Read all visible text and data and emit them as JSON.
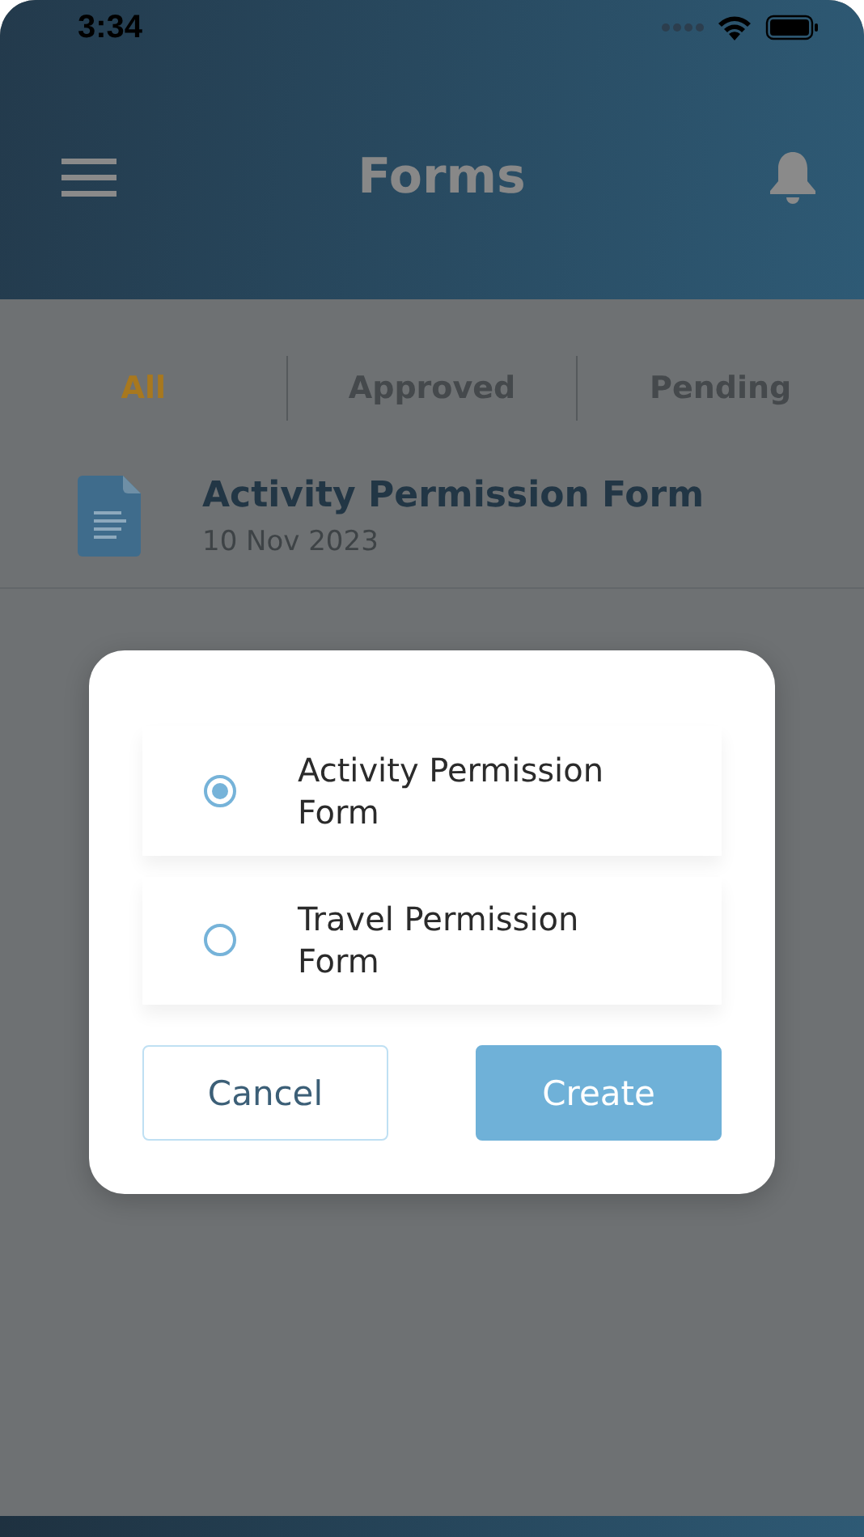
{
  "status_bar": {
    "time": "3:34"
  },
  "header": {
    "title": "Forms"
  },
  "tabs": [
    {
      "label": "All",
      "selected": true
    },
    {
      "label": "Approved",
      "selected": false
    },
    {
      "label": "Pending",
      "selected": false
    }
  ],
  "forms": [
    {
      "title": "Activity Permission Form",
      "date": "10 Nov 2023"
    }
  ],
  "dialog": {
    "options": [
      {
        "label": "Activity Permission Form",
        "selected": true
      },
      {
        "label": "Travel Permission Form",
        "selected": false
      }
    ],
    "buttons": [
      {
        "label": "Cancel",
        "kind": "secondary"
      },
      {
        "label": "Create",
        "kind": "primary"
      }
    ]
  }
}
